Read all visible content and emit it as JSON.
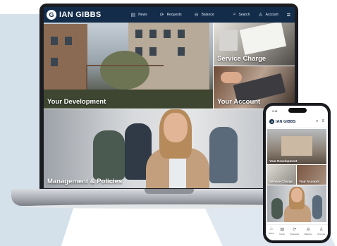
{
  "brand": {
    "name": "IAN GIBBS",
    "mark": "G"
  },
  "laptop": {
    "nav": {
      "items": [
        {
          "label": "News",
          "icon": "newspaper-icon",
          "glyph": "▤"
        },
        {
          "label": "Requests",
          "icon": "refresh-icon",
          "glyph": "⟳"
        },
        {
          "label": "Balance",
          "icon": "balance-icon",
          "glyph": "⊖"
        }
      ],
      "search_label": "Search",
      "account_label": "Account",
      "search_glyph": "⌕",
      "account_glyph": "♙",
      "menu_glyph": "≡"
    },
    "tiles": {
      "development": "Your Development",
      "service_charge": "Service Charge",
      "account": "Your Account",
      "management": "Management & Policies"
    }
  },
  "phone": {
    "status_time": "9:41",
    "tiles": {
      "development": "Your Development",
      "service_charge": "Service Charge",
      "account": "Your Account"
    },
    "search_glyph": "⌕",
    "menu_glyph": "≡",
    "tabbar": [
      {
        "label": "Home",
        "glyph": "⌂"
      },
      {
        "label": "News",
        "glyph": "▤"
      },
      {
        "label": "Requests",
        "glyph": "⟳"
      },
      {
        "label": "Balance",
        "glyph": "⊖"
      },
      {
        "label": "Account",
        "glyph": "♙"
      }
    ]
  },
  "colors": {
    "navy": "#132c4a",
    "background_shape": "#c5d5e3"
  }
}
